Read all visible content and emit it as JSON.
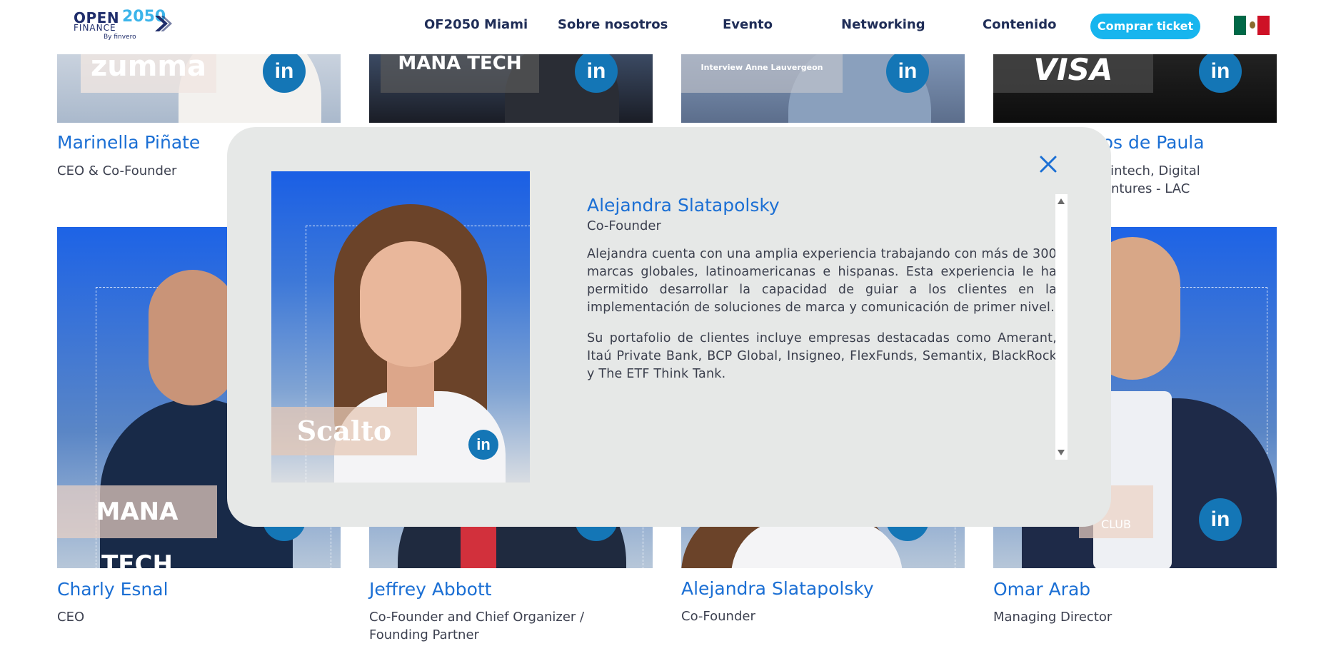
{
  "header": {
    "logo": {
      "line1": "OPEN",
      "year": "2050",
      "line2": "FINANCE",
      "byline": "By finvero"
    },
    "nav": [
      "OF2050 Miami",
      "Sobre nosotros",
      "Evento",
      "Networking",
      "Contenido"
    ],
    "ticket_button": "Comprar ticket",
    "language_flag": "mexico-flag-icon",
    "colors": {
      "brand_navy": "#1f2d57",
      "accent_cyan": "#17b5ee"
    }
  },
  "speakers_top": [
    {
      "name": "Marinella Piñate",
      "role": "CEO & Co-Founder",
      "brand": "zumma"
    },
    {
      "name": "",
      "role": "",
      "brand": "MANA TECH"
    },
    {
      "name": "",
      "role": "",
      "brand": "Interview Anne Lauvergeon"
    },
    {
      "name": "ros de Paula",
      "role_lines": [
        "f Fintech, Digital",
        "Ventures - LAC"
      ],
      "brand": "VISA"
    }
  ],
  "speakers_bottom": [
    {
      "name": "Charly Esnal",
      "role": "CEO",
      "brand": "MANA TECH"
    },
    {
      "name": "Jeffrey Abbott",
      "role_lines": [
        "Co-Founder and Chief Organizer /",
        "Founding Partner"
      ],
      "brand": ""
    },
    {
      "name": "Alejandra Slatapolsky",
      "role": "Co-Founder",
      "brand": ""
    },
    {
      "name": "Omar Arab",
      "role": "Managing Director",
      "brand": "CLUB"
    }
  ],
  "linkedin_label": "in",
  "modal": {
    "name": "Alejandra Slatapolsky",
    "role": "Co-Founder",
    "brand": "Scalto",
    "bio": [
      "Alejandra cuenta con una amplia experiencia trabajando con más de 300 marcas globales, latinoamericanas e hispanas. Esta experiencia le ha permitido desarrollar la capacidad de guiar a los clientes en la implementación de soluciones de marca y comunicación de primer nivel.",
      "Su portafolio de clientes incluye empresas destacadas como Amerant, Itaú Private Bank, BCP Global, Insigneo, FlexFunds, Semantix, BlackRock y The ETF Think Tank."
    ],
    "close_icon": "close-icon"
  }
}
